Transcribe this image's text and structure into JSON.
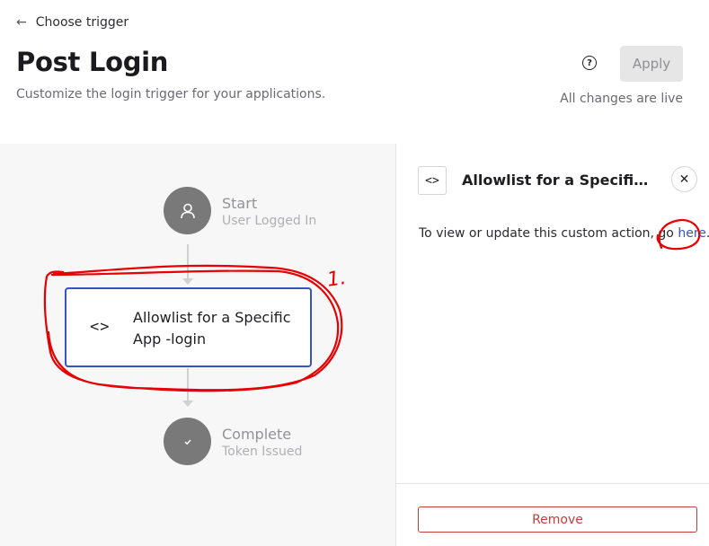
{
  "header": {
    "back_label": "Choose trigger",
    "title": "Post Login",
    "subtitle": "Customize the login trigger for your applications.",
    "help_icon": "question-circle-icon",
    "apply_label": "Apply",
    "live_status": "All changes are live"
  },
  "flow": {
    "start": {
      "title": "Start",
      "subtitle": "User Logged In",
      "icon": "user-icon"
    },
    "action": {
      "label": "Allowlist for a Specific App -login",
      "icon": "code-icon"
    },
    "complete": {
      "title": "Complete",
      "subtitle": "Token Issued",
      "icon": "check-icon"
    }
  },
  "panel": {
    "icon": "code-icon",
    "title": "Allowlist for a Specific App -login",
    "description_prefix": "To view or update this custom action, go ",
    "link_label": "here",
    "description_suffix": ".",
    "remove_label": "Remove"
  },
  "annotation": {
    "label": "1.",
    "color": "#e60000"
  },
  "colors": {
    "accent": "#3a53c2",
    "danger": "#c43c3c",
    "link": "#3555c8"
  }
}
